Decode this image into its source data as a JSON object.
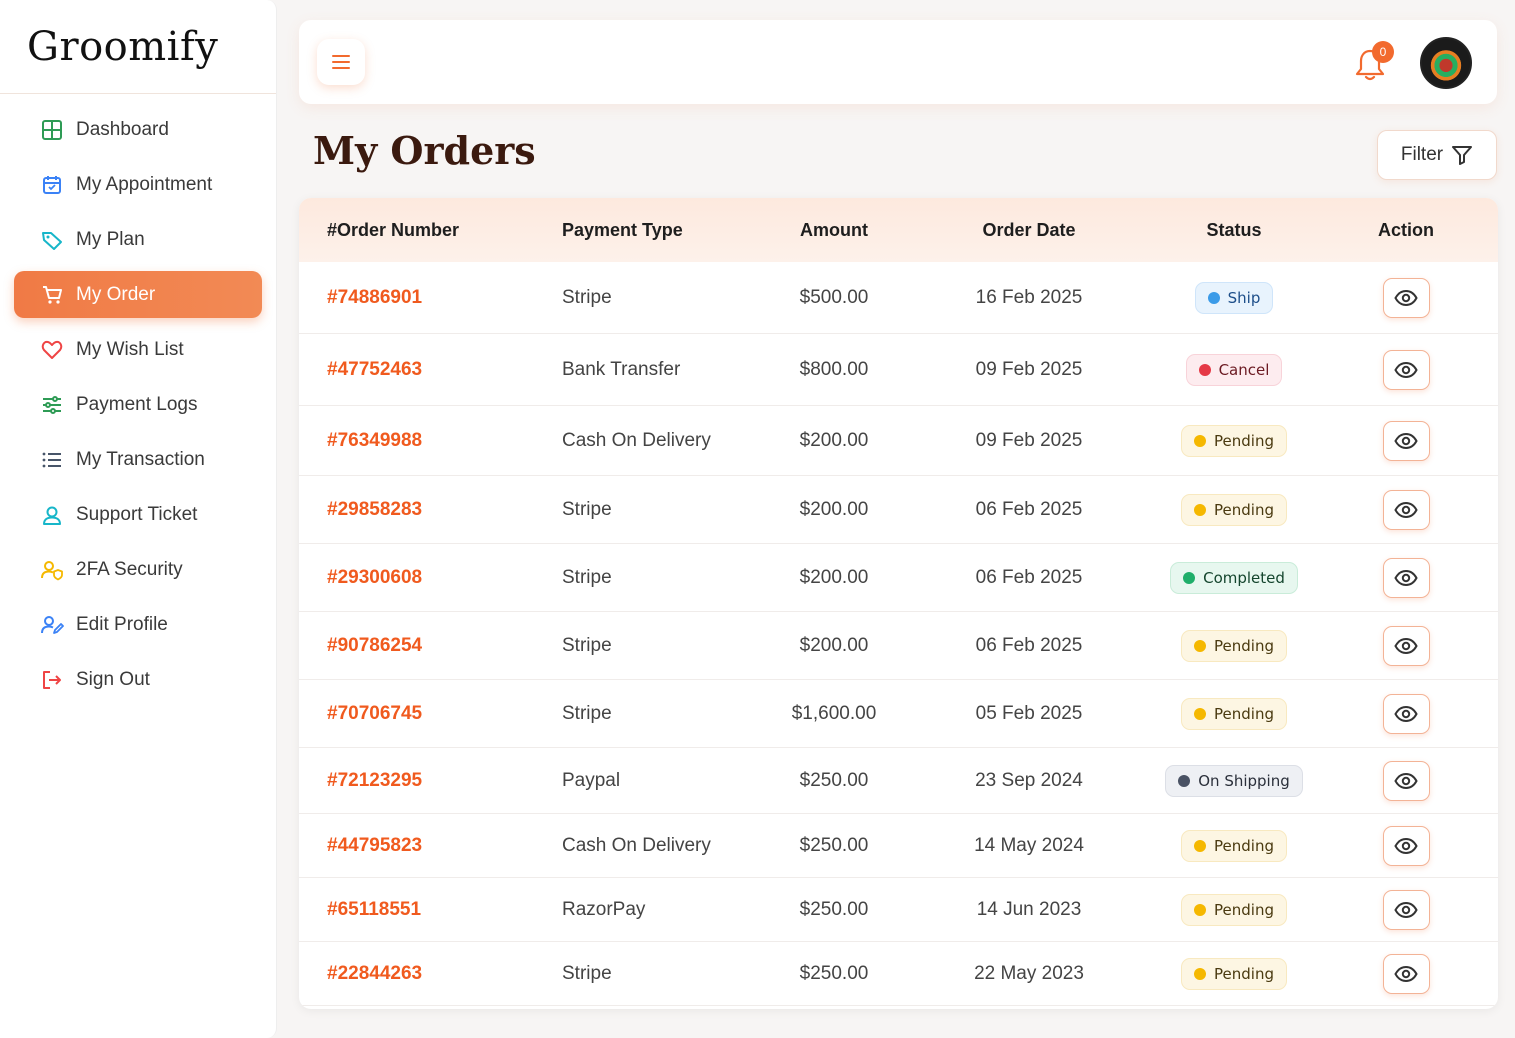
{
  "brand": {
    "name": "Groomify"
  },
  "sidebar": {
    "items": [
      {
        "label": "Dashboard",
        "icon": "grid-icon"
      },
      {
        "label": "My Appointment",
        "icon": "calendar-icon"
      },
      {
        "label": "My Plan",
        "icon": "tag-icon"
      },
      {
        "label": "My Order",
        "icon": "cart-icon",
        "active": true
      },
      {
        "label": "My Wish List",
        "icon": "heart-icon"
      },
      {
        "label": "Payment Logs",
        "icon": "sliders-icon"
      },
      {
        "label": "My Transaction",
        "icon": "list-icon"
      },
      {
        "label": "Support Ticket",
        "icon": "user-support-icon"
      },
      {
        "label": "2FA Security",
        "icon": "user-shield-icon"
      },
      {
        "label": "Edit Profile",
        "icon": "user-edit-icon"
      },
      {
        "label": "Sign Out",
        "icon": "sign-out-icon"
      }
    ]
  },
  "header": {
    "notification_count": "0"
  },
  "page": {
    "title": "My Orders",
    "filter_label": "Filter"
  },
  "table": {
    "columns": [
      "#Order Number",
      "Payment Type",
      "Amount",
      "Order Date",
      "Status",
      "Action"
    ],
    "rows": [
      {
        "order": "#74886901",
        "payment": "Stripe",
        "amount": "$500.00",
        "date": "16 Feb 2025",
        "status": "Ship"
      },
      {
        "order": "#47752463",
        "payment": "Bank Transfer",
        "amount": "$800.00",
        "date": "09 Feb 2025",
        "status": "Cancel"
      },
      {
        "order": "#76349988",
        "payment": "Cash On Delivery",
        "amount": "$200.00",
        "date": "09 Feb 2025",
        "status": "Pending"
      },
      {
        "order": "#29858283",
        "payment": "Stripe",
        "amount": "$200.00",
        "date": "06 Feb 2025",
        "status": "Pending"
      },
      {
        "order": "#29300608",
        "payment": "Stripe",
        "amount": "$200.00",
        "date": "06 Feb 2025",
        "status": "Completed"
      },
      {
        "order": "#90786254",
        "payment": "Stripe",
        "amount": "$200.00",
        "date": "06 Feb 2025",
        "status": "Pending"
      },
      {
        "order": "#70706745",
        "payment": "Stripe",
        "amount": "$1,600.00",
        "date": "05 Feb 2025",
        "status": "Pending"
      },
      {
        "order": "#72123295",
        "payment": "Paypal",
        "amount": "$250.00",
        "date": "23 Sep 2024",
        "status": "On Shipping"
      },
      {
        "order": "#44795823",
        "payment": "Cash On Delivery",
        "amount": "$250.00",
        "date": "14 May 2024",
        "status": "Pending"
      },
      {
        "order": "#65118551",
        "payment": "RazorPay",
        "amount": "$250.00",
        "date": "14 Jun 2023",
        "status": "Pending"
      },
      {
        "order": "#22844263",
        "payment": "Stripe",
        "amount": "$250.00",
        "date": "22 May 2023",
        "status": "Pending"
      }
    ]
  },
  "status_styles": {
    "Ship": {
      "bg": "#e8f3fd",
      "border": "#cfe5fa",
      "dot": "#3b9be8",
      "text": "#1d4e89"
    },
    "Cancel": {
      "bg": "#fdecef",
      "border": "#f8d3d9",
      "dot": "#e53946",
      "text": "#6b1a22"
    },
    "Pending": {
      "bg": "#fdf6e3",
      "border": "#f8e9c0",
      "dot": "#f5b800",
      "text": "#4a3a10"
    },
    "Completed": {
      "bg": "#e7f7ef",
      "border": "#c9ecd9",
      "dot": "#1fae6a",
      "text": "#14452d"
    },
    "On Shipping": {
      "bg": "#eef0f4",
      "border": "#dcdfe6",
      "dot": "#4a5264",
      "text": "#2a2f3a"
    }
  },
  "colors": {
    "accent": "#f07a45",
    "order_number": "#f05a1e"
  }
}
